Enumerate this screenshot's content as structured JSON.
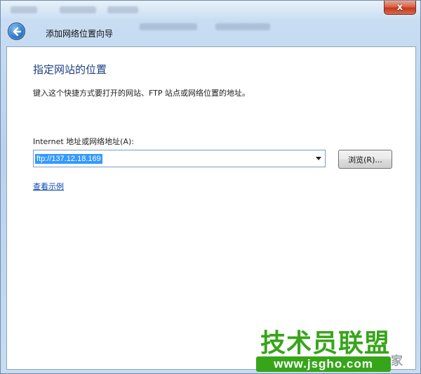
{
  "window": {
    "title": "添加网络位置向导",
    "close_glyph": "x"
  },
  "page": {
    "heading": "指定网站的位置",
    "instruction": "键入这个快捷方式要打开的网站、FTP 站点或网络位置的地址。",
    "address_label": "Internet 地址或网络地址(A):",
    "address_value": "ftp://137.12.18.169",
    "browse_label": "浏览(R)...",
    "example_link": "查看示例"
  },
  "watermark": {
    "text": "技术员联盟",
    "url": "www.jsgho.com",
    "side": "家"
  },
  "colors": {
    "heading": "#1c3e7e",
    "link": "#0645ad",
    "selection": "#3399ff",
    "watermark_green": "#37a51a"
  }
}
